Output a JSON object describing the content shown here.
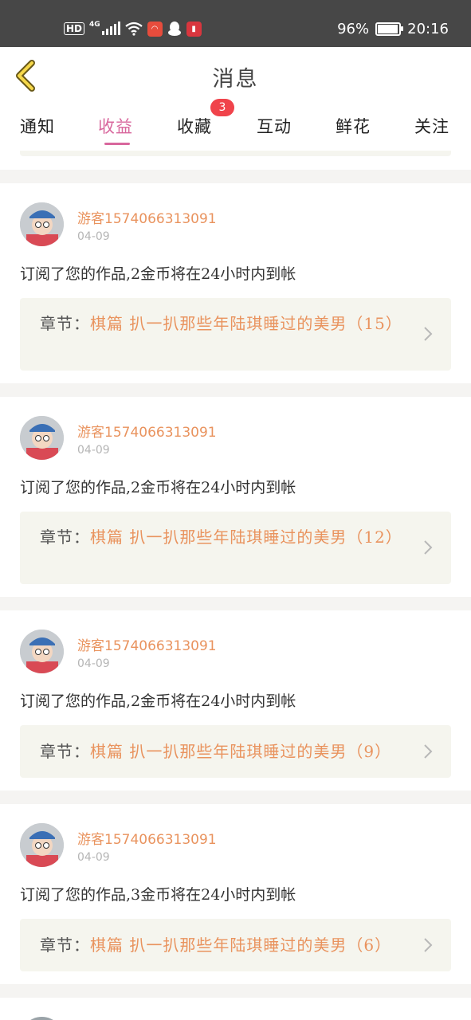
{
  "status_bar": {
    "hd": "HD",
    "network": "4G",
    "battery_percent": "96%",
    "battery_level": 0.96,
    "time": "20:16",
    "icons": [
      "signal-icon",
      "wifi-icon",
      "app-notification-icon",
      "qq-icon",
      "reader-app-icon",
      "battery-icon"
    ]
  },
  "header": {
    "title": "消息",
    "back_icon": "chevron-left-icon"
  },
  "tabs": {
    "items": [
      "通知",
      "收益",
      "收藏",
      "互动",
      "鲜花",
      "关注"
    ],
    "active": "收益",
    "badge_count": "3"
  },
  "cards": [
    {
      "username": "游客1574066313091",
      "date": "04-09",
      "message": "订阅了您的作品,2金币将在24小时内到帐",
      "chapter_label": "章节：",
      "chapter_title": "棋篇 扒一扒那些年陆琪睡过的美男（15）"
    },
    {
      "username": "游客1574066313091",
      "date": "04-09",
      "message": "订阅了您的作品,2金币将在24小时内到帐",
      "chapter_label": "章节：",
      "chapter_title": "棋篇 扒一扒那些年陆琪睡过的美男（12）"
    },
    {
      "username": "游客1574066313091",
      "date": "04-09",
      "message": "订阅了您的作品,2金币将在24小时内到帐",
      "chapter_label": "章节：",
      "chapter_title": "棋篇 扒一扒那些年陆琪睡过的美男（9）"
    },
    {
      "username": "游客1574066313091",
      "date": "04-09",
      "message": "订阅了您的作品,3金币将在24小时内到帐",
      "chapter_label": "章节：",
      "chapter_title": "棋篇 扒一扒那些年陆琪睡过的美男（6）"
    }
  ],
  "colors": {
    "accent_pink": "#d8679d",
    "username_orange": "#e9935e",
    "badge_red": "#f0434b",
    "status_bar": "#474747",
    "chapter_bg": "#f5f5ee"
  }
}
